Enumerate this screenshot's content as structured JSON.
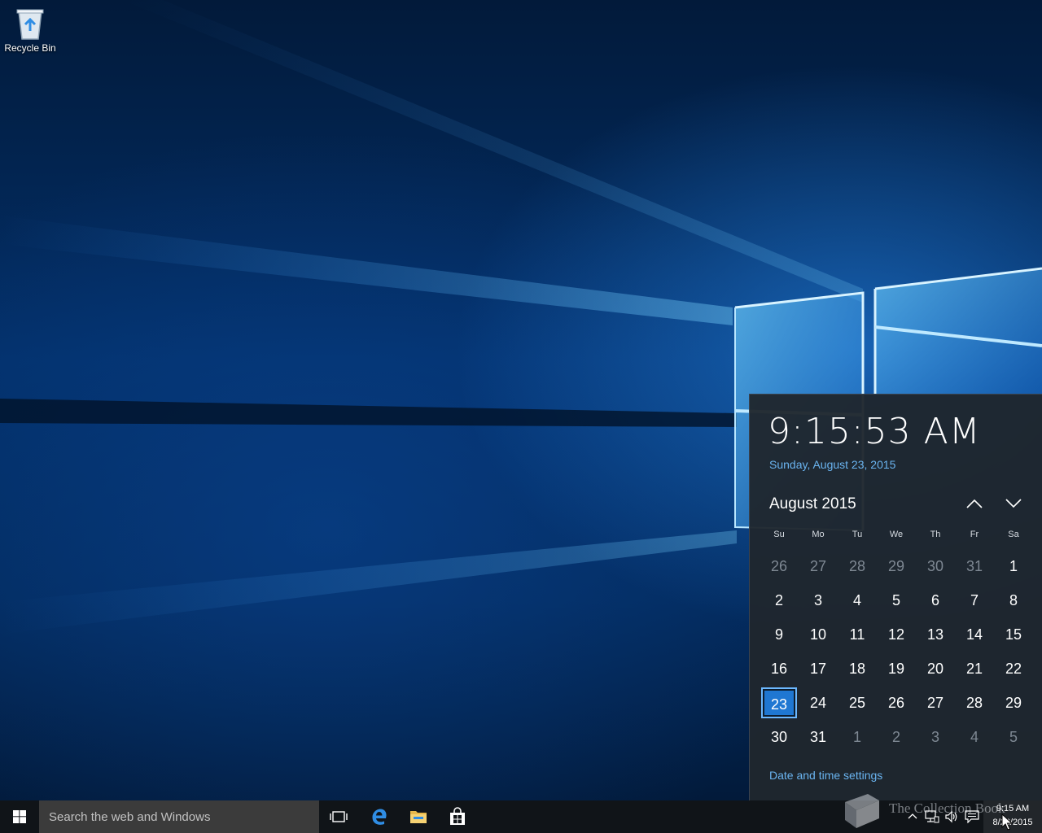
{
  "desktop": {
    "icons": [
      {
        "label": "Recycle Bin",
        "icon": "recycle-bin-icon"
      }
    ]
  },
  "flyout": {
    "time": "9:15:53 AM",
    "long_date": "Sunday, August 23, 2015",
    "month_label": "August 2015",
    "weekdays": [
      "Su",
      "Mo",
      "Tu",
      "We",
      "Th",
      "Fr",
      "Sa"
    ],
    "weeks": [
      [
        "26",
        "27",
        "28",
        "29",
        "30",
        "31",
        "1"
      ],
      [
        "2",
        "3",
        "4",
        "5",
        "6",
        "7",
        "8"
      ],
      [
        "9",
        "10",
        "11",
        "12",
        "13",
        "14",
        "15"
      ],
      [
        "16",
        "17",
        "18",
        "19",
        "20",
        "21",
        "22"
      ],
      [
        "23",
        "24",
        "25",
        "26",
        "27",
        "28",
        "29"
      ],
      [
        "30",
        "31",
        "1",
        "2",
        "3",
        "4",
        "5"
      ]
    ],
    "selected_day": "23",
    "settings_link": "Date and time settings"
  },
  "taskbar": {
    "search_placeholder": "Search the web and Windows",
    "pinned": [
      {
        "name": "task-view",
        "icon": "task-view-icon"
      },
      {
        "name": "edge",
        "icon": "edge-icon"
      },
      {
        "name": "file-explorer",
        "icon": "folder-icon"
      },
      {
        "name": "store",
        "icon": "store-icon"
      }
    ],
    "tray": {
      "time": "9:15 AM",
      "date": "8/23/2015"
    },
    "watermark": "The Collection Book"
  },
  "colors": {
    "accent": "#1f77d2",
    "link": "#6ab4f0",
    "flyout_bg": "#1f262e",
    "taskbar_bg": "#101418"
  }
}
